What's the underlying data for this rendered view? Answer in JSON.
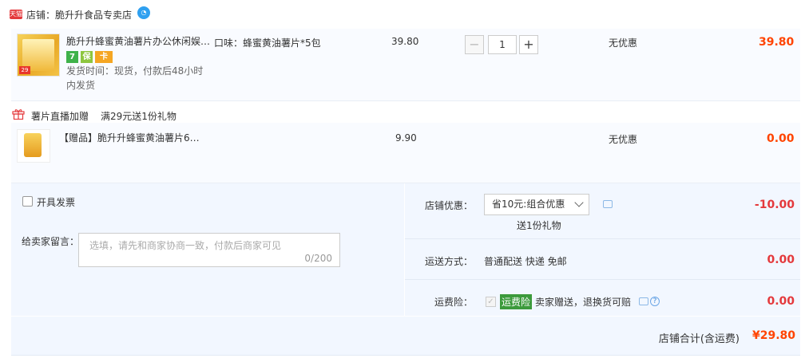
{
  "store": {
    "badge": "天猫",
    "label": "店铺：脆升升食品专卖店"
  },
  "items": [
    {
      "thumb_tag": "29",
      "title": "脆升升蜂蜜黄油薯片办公休闲娱…",
      "sku": "口味：蜂蜜黄油薯片*5包",
      "service_icons": [
        "7",
        "保",
        "卡"
      ],
      "ship_line1": "发货时间：现货，付款后48小时",
      "ship_line2": "内发货",
      "unit_price": "39.80",
      "quantity": "1",
      "promo": "无优惠",
      "subtotal": "39.80"
    },
    {
      "title": "【赠品】脆升升蜂蜜黄油薯片6…",
      "unit_price": "9.90",
      "promo": "无优惠",
      "subtotal": "0.00"
    }
  ],
  "gift": {
    "name": "薯片直播加赠",
    "rule": "满29元送1份礼物"
  },
  "invoice": {
    "label": "开具发票"
  },
  "message": {
    "label": "给卖家留言：",
    "placeholder": "选填，请先和商家协商一致，付款后商家可见",
    "counter": "0/200"
  },
  "discount": {
    "label": "店铺优惠：",
    "selected": "省10元:组合优惠",
    "note": "送1份礼物",
    "amount": "-10.00"
  },
  "shipping": {
    "label": "运送方式：",
    "value": "普通配送 快递 免邮",
    "amount": "0.00"
  },
  "insurance": {
    "label": "运费险：",
    "badge": "运费险",
    "text": "卖家赠送，退换货可赔",
    "amount": "0.00"
  },
  "summary": {
    "label": "店铺合计(含运费)",
    "total": "¥29.80"
  },
  "colors": {
    "accent": "#ff4400",
    "red": "#e4393c",
    "panel": "#f2f7ff",
    "item_bg": "#f9fbff"
  }
}
